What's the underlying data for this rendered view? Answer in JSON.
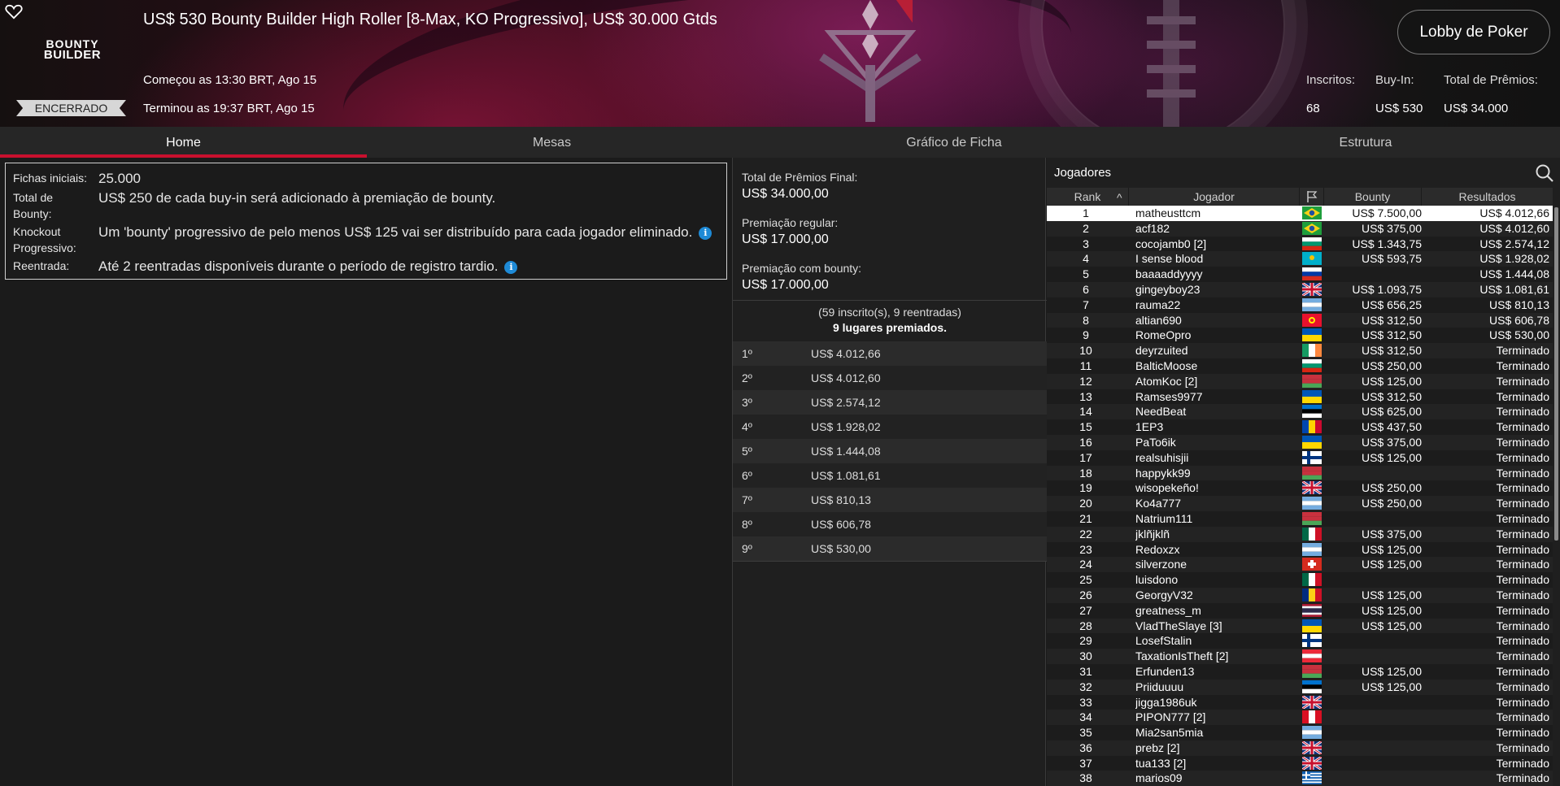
{
  "header": {
    "logo_line1": "BOUNTY",
    "logo_line2": "BUILDER",
    "status": "ENCERRADO",
    "title": "US$ 530 Bounty Builder High Roller [8-Max, KO Progressivo], US$ 30.000 Gtds",
    "started": "Começou as 13:30 BRT, Ago 15",
    "ended": "Terminou as 19:37 BRT, Ago 15",
    "lobby_button": "Lobby de Poker",
    "stats": {
      "entrants_label": "Inscritos:",
      "entrants_value": "68",
      "buyin_label": "Buy-In:",
      "buyin_value": "US$ 530",
      "prize_label": "Total de Prêmios:",
      "prize_value": "US$ 34.000"
    }
  },
  "tabs": [
    {
      "label": "Home",
      "active": true
    },
    {
      "label": "Mesas",
      "active": false
    },
    {
      "label": "Gráfico de Ficha",
      "active": false
    },
    {
      "label": "Estrutura",
      "active": false
    }
  ],
  "info": {
    "starting_chips_label": "Fichas iniciais:",
    "starting_chips_value": "25.000",
    "bounty_total_label": "Total de Bounty:",
    "bounty_total_value": "US$ 250 de cada buy-in será adicionado à premiação de bounty.",
    "knockout_label": "Knockout Progressivo:",
    "knockout_value": "Um 'bounty' progressivo de pelo menos US$ 125 vai ser distribuído para cada jogador eliminado.",
    "reentry_label": "Reentrada:",
    "reentry_value": "Até 2 reentradas disponíveis durante o período de registro tardio.",
    "info_glyph": "i"
  },
  "prizes": {
    "final_total_label": "Total de Prêmios Final:",
    "final_total_value": "US$ 34.000,00",
    "regular_label": "Premiação regular:",
    "regular_value": "US$ 17.000,00",
    "bounty_label": "Premiação com bounty:",
    "bounty_value": "US$ 17.000,00",
    "summary_line1": "(59 inscrito(s), 9 reentradas)",
    "summary_line2": "9 lugares premiados.",
    "places": [
      {
        "place": "1º",
        "amount": "US$ 4.012,66"
      },
      {
        "place": "2º",
        "amount": "US$ 4.012,60"
      },
      {
        "place": "3º",
        "amount": "US$ 2.574,12"
      },
      {
        "place": "4º",
        "amount": "US$ 1.928,02"
      },
      {
        "place": "5º",
        "amount": "US$ 1.444,08"
      },
      {
        "place": "6º",
        "amount": "US$ 1.081,61"
      },
      {
        "place": "7º",
        "amount": "US$ 810,13"
      },
      {
        "place": "8º",
        "amount": "US$ 606,78"
      },
      {
        "place": "9º",
        "amount": "US$ 530,00"
      }
    ]
  },
  "players": {
    "title": "Jogadores",
    "columns": {
      "rank": "Rank",
      "sort_glyph": "^",
      "name": "Jogador",
      "bounty": "Bounty",
      "results": "Resultados"
    },
    "flag_colors": {
      "br": [
        "#1f9e3c",
        "#f7d117",
        "#1f4ea1"
      ],
      "kz": [
        "#00afca",
        "#f4c300"
      ],
      "gb": [
        "#12307a",
        "#ffffff",
        "#c8102e"
      ],
      "ar": [
        "#74acdf",
        "#ffffff",
        "#74acdf"
      ],
      "kg": [
        "#e8112d",
        "#ffef00"
      ],
      "ua": [
        "#0057b7",
        "#ffd700"
      ],
      "ie": [
        "#169b62",
        "#ffffff",
        "#ff883e"
      ],
      "bg": [
        "#ffffff",
        "#00966e",
        "#d62612"
      ],
      "by": [
        "#c8313e",
        "#c8313e",
        "#4aa657"
      ],
      "ro": [
        "#002b7f",
        "#fcd116",
        "#ce1126"
      ],
      "ee": [
        "#0072ce",
        "#000000",
        "#ffffff"
      ],
      "md": [
        "#0046ae",
        "#ffd200",
        "#cc092f"
      ],
      "pe": [
        "#d91023",
        "#ffffff",
        "#d91023"
      ],
      "fi": [
        "#ffffff",
        "#003580"
      ],
      "mx": [
        "#006847",
        "#ffffff",
        "#ce1126"
      ],
      "ch": [
        "#d52b1e",
        "#ffffff"
      ],
      "th": [
        "#a51931",
        "#f4f5f8",
        "#2d2a4a"
      ],
      "at": [
        "#ed2939",
        "#ffffff",
        "#ed2939"
      ],
      "ru": [
        "#ffffff",
        "#0039a6",
        "#d52b1e"
      ],
      "gr": [
        "#0d5eaf",
        "#ffffff"
      ]
    },
    "rows": [
      {
        "rank": "1",
        "name": "matheusttcm",
        "flag": "br",
        "bounty": "US$ 7.500,00",
        "result": "US$ 4.012,66",
        "selected": true
      },
      {
        "rank": "2",
        "name": "acf182",
        "flag": "br",
        "bounty": "US$ 375,00",
        "result": "US$ 4.012,60"
      },
      {
        "rank": "3",
        "name": "cocojamb0 [2]",
        "flag": "bg",
        "bounty": "US$ 1.343,75",
        "result": "US$ 2.574,12"
      },
      {
        "rank": "4",
        "name": "I sense blood",
        "flag": "kz",
        "bounty": "US$ 593,75",
        "result": "US$ 1.928,02"
      },
      {
        "rank": "5",
        "name": "baaaaddyyyy",
        "flag": "ru",
        "bounty": "",
        "result": "US$ 1.444,08"
      },
      {
        "rank": "6",
        "name": "gingeyboy23",
        "flag": "gb",
        "bounty": "US$ 1.093,75",
        "result": "US$ 1.081,61"
      },
      {
        "rank": "7",
        "name": "rauma22",
        "flag": "ar",
        "bounty": "US$ 656,25",
        "result": "US$ 810,13"
      },
      {
        "rank": "8",
        "name": "altian690",
        "flag": "kg",
        "bounty": "US$ 312,50",
        "result": "US$ 606,78"
      },
      {
        "rank": "9",
        "name": "RomeOpro",
        "flag": "ua",
        "bounty": "US$ 312,50",
        "result": "US$ 530,00"
      },
      {
        "rank": "10",
        "name": "deyrzuited",
        "flag": "ie",
        "bounty": "US$ 312,50",
        "result": "Terminado"
      },
      {
        "rank": "11",
        "name": "BalticMoose",
        "flag": "bg",
        "bounty": "US$ 250,00",
        "result": "Terminado"
      },
      {
        "rank": "12",
        "name": "AtomKoc [2]",
        "flag": "by",
        "bounty": "US$ 125,00",
        "result": "Terminado"
      },
      {
        "rank": "13",
        "name": "Ramses9977",
        "flag": "ua",
        "bounty": "US$ 312,50",
        "result": "Terminado"
      },
      {
        "rank": "14",
        "name": "NeedBeat",
        "flag": "ee",
        "bounty": "US$ 625,00",
        "result": "Terminado"
      },
      {
        "rank": "15",
        "name": "1EP3",
        "flag": "md",
        "bounty": "US$ 437,50",
        "result": "Terminado"
      },
      {
        "rank": "16",
        "name": "PaTo6ik",
        "flag": "ua",
        "bounty": "US$ 375,00",
        "result": "Terminado"
      },
      {
        "rank": "17",
        "name": "realsuhisjii",
        "flag": "fi",
        "bounty": "US$ 125,00",
        "result": "Terminado"
      },
      {
        "rank": "18",
        "name": "happykk99",
        "flag": "by",
        "bounty": "",
        "result": "Terminado"
      },
      {
        "rank": "19",
        "name": "wisopekeño!",
        "flag": "gb",
        "bounty": "US$ 250,00",
        "result": "Terminado"
      },
      {
        "rank": "20",
        "name": "Ko4a777",
        "flag": "ar",
        "bounty": "US$ 250,00",
        "result": "Terminado"
      },
      {
        "rank": "21",
        "name": "Natrium111",
        "flag": "by",
        "bounty": "",
        "result": "Terminado"
      },
      {
        "rank": "22",
        "name": "jklñjklñ",
        "flag": "mx",
        "bounty": "US$ 375,00",
        "result": "Terminado"
      },
      {
        "rank": "23",
        "name": "Redoxzx",
        "flag": "ar",
        "bounty": "US$ 125,00",
        "result": "Terminado"
      },
      {
        "rank": "24",
        "name": "silverzone",
        "flag": "ch",
        "bounty": "US$ 125,00",
        "result": "Terminado"
      },
      {
        "rank": "25",
        "name": "luisdono",
        "flag": "mx",
        "bounty": "",
        "result": "Terminado"
      },
      {
        "rank": "26",
        "name": "GeorgyV32",
        "flag": "ro",
        "bounty": "US$ 125,00",
        "result": "Terminado"
      },
      {
        "rank": "27",
        "name": "greatness_m",
        "flag": "th",
        "bounty": "US$ 125,00",
        "result": "Terminado"
      },
      {
        "rank": "28",
        "name": "VladTheSlaye [3]",
        "flag": "ua",
        "bounty": "US$ 125,00",
        "result": "Terminado"
      },
      {
        "rank": "29",
        "name": "LosefStalin",
        "flag": "fi",
        "bounty": "",
        "result": "Terminado"
      },
      {
        "rank": "30",
        "name": "TaxationIsTheft [2]",
        "flag": "at",
        "bounty": "",
        "result": "Terminado"
      },
      {
        "rank": "31",
        "name": "Erfunden13",
        "flag": "by",
        "bounty": "US$ 125,00",
        "result": "Terminado"
      },
      {
        "rank": "32",
        "name": "Priiduuuu",
        "flag": "ee",
        "bounty": "US$ 125,00",
        "result": "Terminado"
      },
      {
        "rank": "33",
        "name": "jigga1986uk",
        "flag": "gb",
        "bounty": "",
        "result": "Terminado"
      },
      {
        "rank": "34",
        "name": "PIPON777 [2]",
        "flag": "pe",
        "bounty": "",
        "result": "Terminado"
      },
      {
        "rank": "35",
        "name": "Mia2san5mia",
        "flag": "ar",
        "bounty": "",
        "result": "Terminado"
      },
      {
        "rank": "36",
        "name": "prebz [2]",
        "flag": "gb",
        "bounty": "",
        "result": "Terminado"
      },
      {
        "rank": "37",
        "name": "tua133 [2]",
        "flag": "gb",
        "bounty": "",
        "result": "Terminado"
      },
      {
        "rank": "38",
        "name": "marios09",
        "flag": "gr",
        "bounty": "",
        "result": "Terminado"
      }
    ]
  }
}
